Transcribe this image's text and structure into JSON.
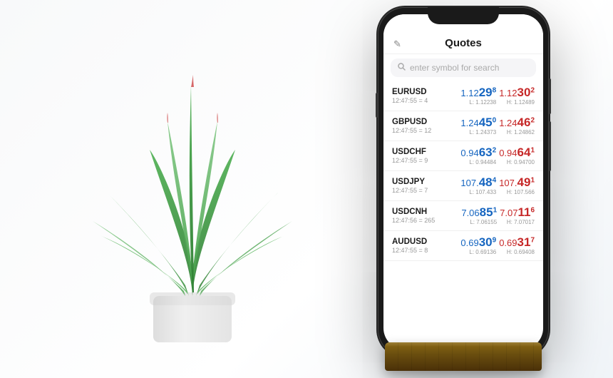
{
  "background": "#ffffff",
  "phone": {
    "header": {
      "title": "Quotes",
      "edit_icon": "✎"
    },
    "search": {
      "placeholder": "enter symbol for search"
    },
    "quotes": [
      {
        "symbol": "EURUSD",
        "time": "12:47:55 = 4",
        "bid_main": "1.12",
        "bid_big": "29",
        "bid_sup": "8",
        "ask_main": "1.12",
        "ask_big": "30",
        "ask_sup": "2",
        "low": "L: 1.12238",
        "high": "H: 1.12489",
        "bid_color": "blue",
        "ask_color": "red"
      },
      {
        "symbol": "GBPUSD",
        "time": "12:47:55 = 12",
        "bid_main": "1.24",
        "bid_big": "45",
        "bid_sup": "0",
        "ask_main": "1.24",
        "ask_big": "46",
        "ask_sup": "2",
        "low": "L: 1.24373",
        "high": "H: 1.24862",
        "bid_color": "blue",
        "ask_color": "red"
      },
      {
        "symbol": "USDCHF",
        "time": "12:47:55 = 9",
        "bid_main": "0.94",
        "bid_big": "63",
        "bid_sup": "2",
        "ask_main": "0.94",
        "ask_big": "64",
        "ask_sup": "1",
        "low": "L: 0.94484",
        "high": "H: 0.94700",
        "bid_color": "blue",
        "ask_color": "red"
      },
      {
        "symbol": "USDJPY",
        "time": "12:47:55 = 7",
        "bid_main": "107.",
        "bid_big": "48",
        "bid_sup": "4",
        "ask_main": "107.",
        "ask_big": "49",
        "ask_sup": "1",
        "low": "L: 107.433",
        "high": "H: 107.566",
        "bid_color": "blue",
        "ask_color": "red"
      },
      {
        "symbol": "USDCNH",
        "time": "12:47:56 = 265",
        "bid_main": "7.06",
        "bid_big": "85",
        "bid_sup": "1",
        "ask_main": "7.07",
        "ask_big": "11",
        "ask_sup": "6",
        "low": "L: 7.06155",
        "high": "H: 7.07017",
        "bid_color": "blue",
        "ask_color": "red"
      },
      {
        "symbol": "AUDUSD",
        "time": "12:47:55 = 8",
        "bid_main": "0.69",
        "bid_big": "30",
        "bid_sup": "9",
        "ask_main": "0.69",
        "ask_big": "31",
        "ask_sup": "7",
        "low": "L: 0.69136",
        "high": "H: 0.69408",
        "bid_color": "blue",
        "ask_color": "red"
      }
    ]
  }
}
